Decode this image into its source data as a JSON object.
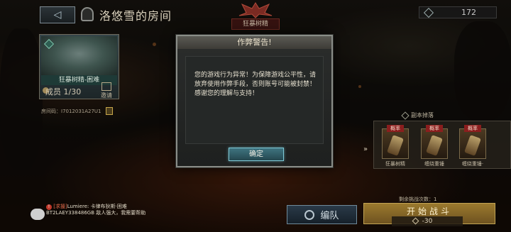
{
  "header": {
    "back_icon": "back-arrow-icon",
    "room_title": "洛悠雪的房间",
    "boss_label": "狂暴树精",
    "currency_value": "172"
  },
  "boss_card": {
    "name": "狂暴树精-困难",
    "members": "成员 1/30",
    "invite_label": "邀请"
  },
  "room_code": "房间码：I7012031A27U1",
  "drops": {
    "title": "副本掉落",
    "items": [
      {
        "badge": "概率",
        "label": "狂暴树精"
      },
      {
        "badge": "概率",
        "label": "缠绕重锤"
      },
      {
        "badge": "概率",
        "label": "缠绕重锤·"
      }
    ]
  },
  "attempts": "剩余挑战次数：1",
  "buttons": {
    "team": "编队",
    "start": "开始战斗",
    "start_cost": "-30"
  },
  "chat": {
    "tag": "[求援]",
    "text": "Lumiere: 卡律布狄斯·困难 BT2LAEY338486GB 敌人强大，我需要帮助"
  },
  "modal": {
    "title": "作弊警告!",
    "message": "您的游戏行为异常！为保障游戏公平性，请放弃使用作弊手段，否则账号可能被封禁！感谢您的理解与支持！",
    "confirm": "确定"
  },
  "colors": {
    "accent_gold": "#c2a454",
    "confirm_teal": "#3f7480",
    "badge_red": "#8a1e1e"
  }
}
